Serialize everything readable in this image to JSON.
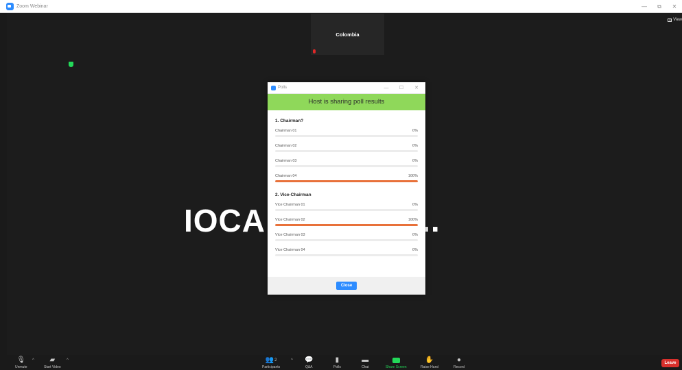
{
  "window": {
    "title": "Zoom Webinar",
    "controls": [
      "—",
      "⧉",
      "✕"
    ]
  },
  "stage": {
    "view_label": "View",
    "thumbnail_name": "Colombia",
    "speaker_display_name": "IOCA Complex..."
  },
  "poll": {
    "window_title": "Polls",
    "controls": [
      "—",
      "☐",
      "✕"
    ],
    "banner": "Host is sharing poll results",
    "close_label": "Close",
    "questions": [
      {
        "title": "1. Chairman?",
        "options": [
          {
            "label": "Chairman 01",
            "percent_label": "0%",
            "value": 0
          },
          {
            "label": "Chairman 02",
            "percent_label": "0%",
            "value": 0
          },
          {
            "label": "Chairman 03",
            "percent_label": "0%",
            "value": 0
          },
          {
            "label": "Chairman 04",
            "percent_label": "100%",
            "value": 100
          }
        ]
      },
      {
        "title": "2. Vice-Chairman",
        "options": [
          {
            "label": "Vice Chairman 01",
            "percent_label": "0%",
            "value": 0
          },
          {
            "label": "Vice Chairman 02",
            "percent_label": "100%",
            "value": 100
          },
          {
            "label": "Vice Chairman 03",
            "percent_label": "0%",
            "value": 0
          },
          {
            "label": "Vice Chairman 04",
            "percent_label": "0%",
            "value": 0
          }
        ]
      }
    ]
  },
  "toolbar": {
    "unmute": "Unmute",
    "start_video": "Start Video",
    "participants": "Participants",
    "participant_count": "2",
    "qa": "Q&A",
    "polls": "Polls",
    "chat": "Chat",
    "share_screen": "Share Screen",
    "raise_hand": "Raise Hand",
    "record": "Record",
    "leave": "Leave"
  },
  "colors": {
    "accent": "#2d8cff",
    "poll_banner": "#8fd85a",
    "result_bar": "#e8713a",
    "leave": "#d9302c",
    "share": "#23d959"
  }
}
